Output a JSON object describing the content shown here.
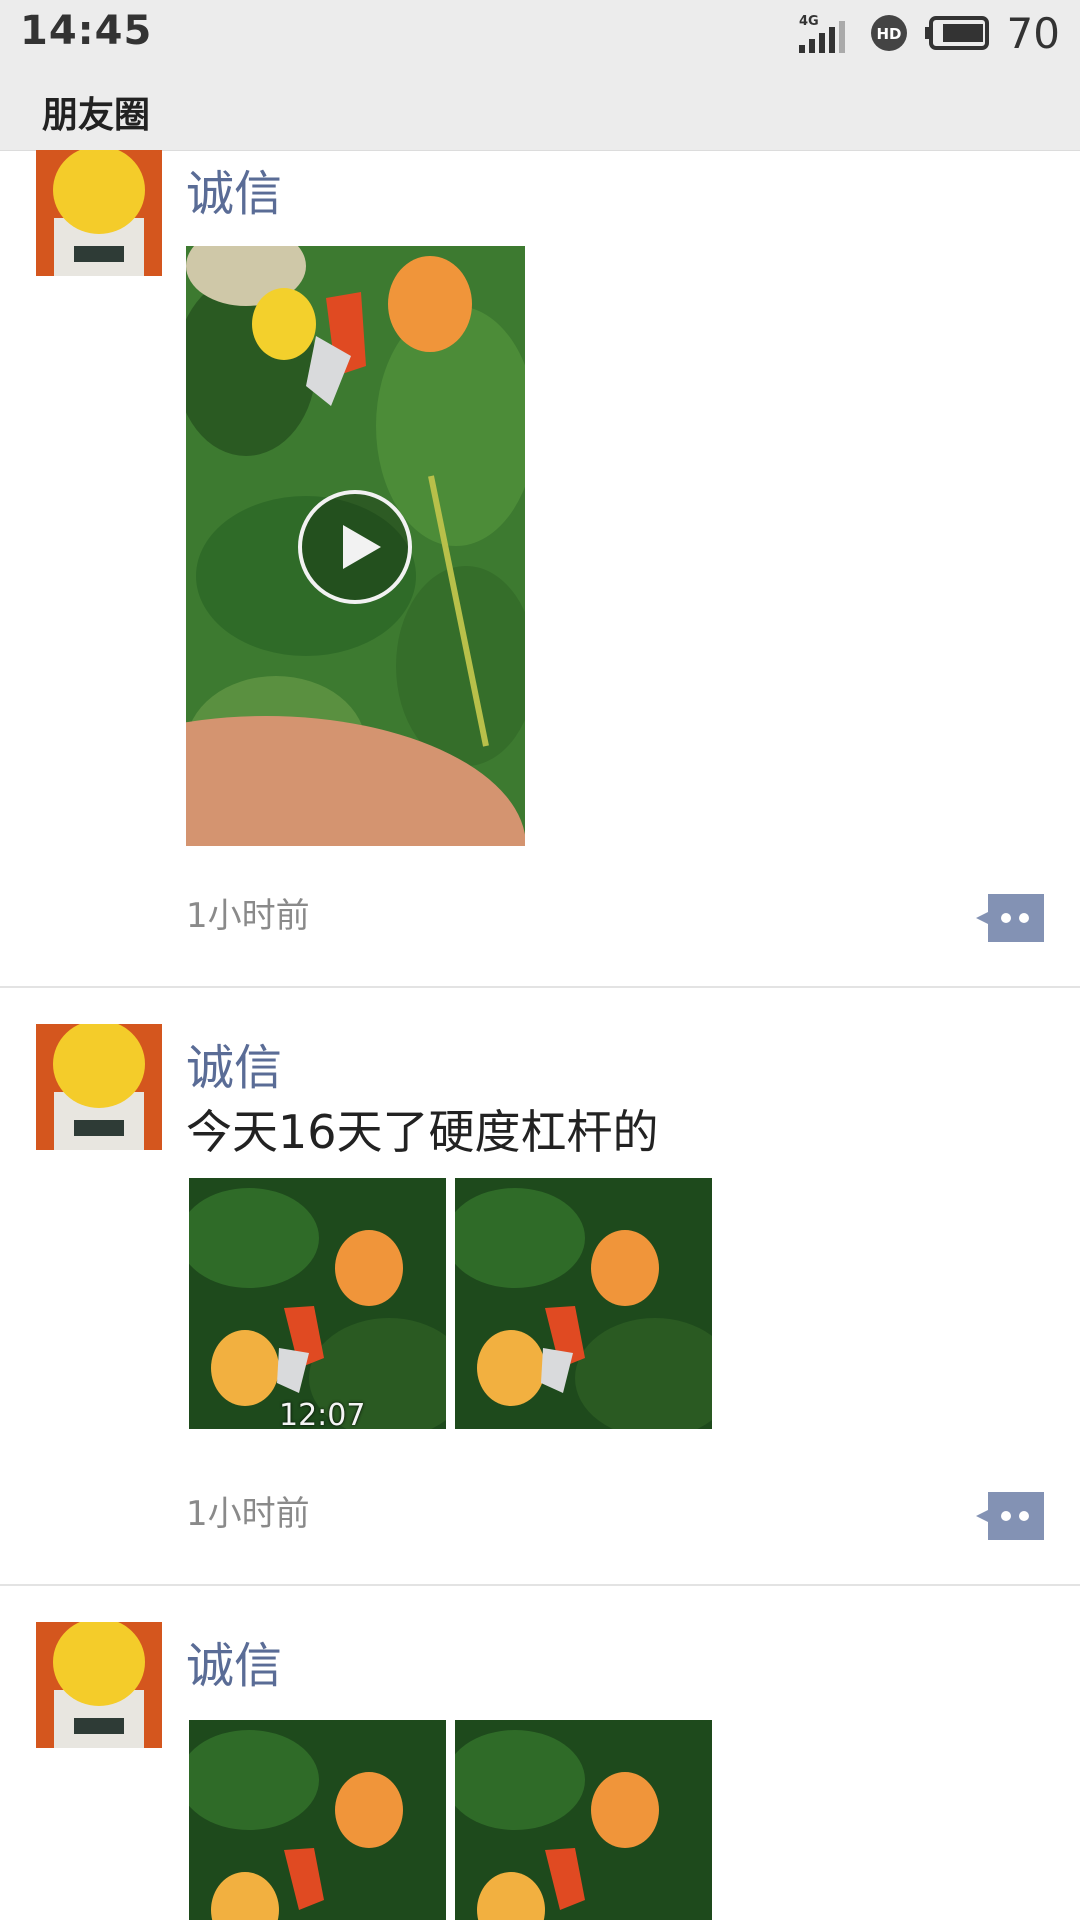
{
  "status_bar": {
    "time": "14:45",
    "network": "4G",
    "hd_icon": "hd-voice-icon",
    "battery": "70"
  },
  "app_bar": {
    "title": "朋友圈"
  },
  "posts": [
    {
      "user": "诚信",
      "text": "",
      "media_type": "video",
      "time": "1小时前"
    },
    {
      "user": "诚信",
      "text": "今天16天了硬度杠杆的",
      "media_type": "images",
      "image_caption": "12:07",
      "time": "1小时前"
    },
    {
      "user": "诚信",
      "text": "",
      "media_type": "images"
    }
  ],
  "colors": {
    "username": "#5a6c96",
    "comment_button": "#8392b4",
    "leaf_green": "#2f6b28",
    "peach": "#f0a05a"
  }
}
